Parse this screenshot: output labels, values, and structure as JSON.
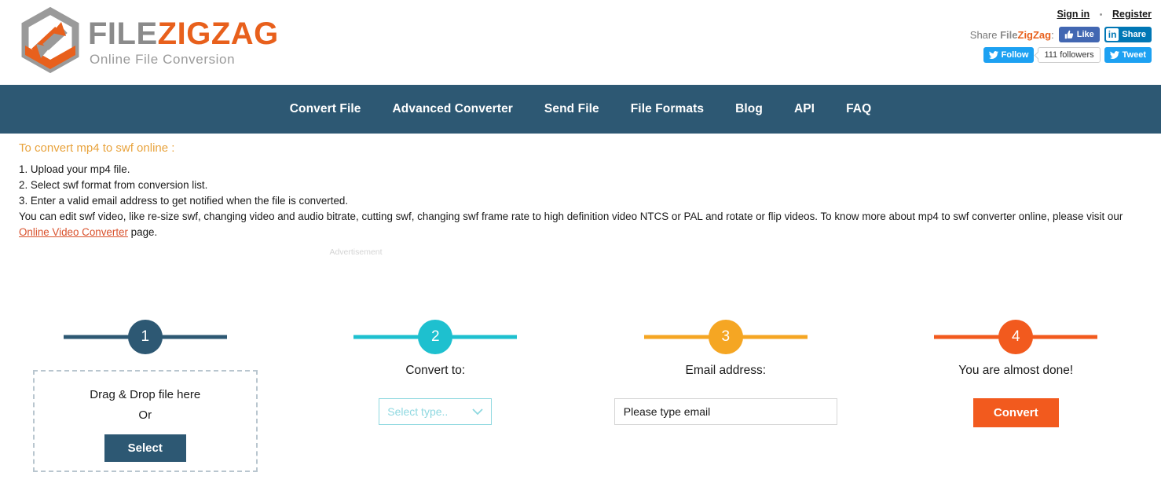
{
  "header": {
    "logo": {
      "title_part1": "FILE",
      "title_part2": "ZIGZAG",
      "tagline": "Online File Conversion",
      "colors": {
        "gray": "#8b8b8b",
        "orange": "#e8601c"
      }
    },
    "auth": {
      "sign_in": "Sign in",
      "separator": "•",
      "register": "Register"
    },
    "share": {
      "label_prefix": "Share ",
      "brand_part1": "File",
      "brand_part2": "ZigZag",
      "label_suffix": ":",
      "facebook_like": "Like",
      "linkedin_badge": "in",
      "linkedin_share": "Share",
      "twitter_follow": "Follow",
      "followers_count": "111 followers",
      "twitter_tweet": "Tweet"
    }
  },
  "nav": {
    "items": [
      {
        "label": "Convert File"
      },
      {
        "label": "Advanced Converter"
      },
      {
        "label": "Send File"
      },
      {
        "label": "File Formats"
      },
      {
        "label": "Blog"
      },
      {
        "label": "API"
      },
      {
        "label": "FAQ"
      }
    ]
  },
  "intro": {
    "title": "To convert mp4 to swf online :",
    "step1": "1. Upload your mp4 file.",
    "step2": "2. Select swf format from conversion list.",
    "step3": "3. Enter a valid email address to get notified when the file is converted.",
    "paragraph_before": "You can edit swf video, like re-size swf, changing video and audio bitrate, cutting swf, changing swf frame rate to high definition video NTCS or PAL and rotate or flip videos. To know more about mp4 to swf converter online, please visit our ",
    "paragraph_link": "Online Video Converter",
    "paragraph_after": " page.",
    "ad_label": "Advertisement"
  },
  "steps": [
    {
      "number": "1",
      "color": "#2d5873",
      "dropzone_line1": "Drag & Drop file here",
      "dropzone_line2": "Or",
      "select_button": "Select"
    },
    {
      "number": "2",
      "color": "#1ec0cf",
      "label": "Convert to:",
      "select_value": "Select type..",
      "select_border": "#8fd8e0"
    },
    {
      "number": "3",
      "color": "#f5a623",
      "label": "Email address:",
      "email_placeholder": "Please type email"
    },
    {
      "number": "4",
      "color": "#f25a1e",
      "label": "You are almost done!",
      "convert_button": "Convert"
    }
  ]
}
